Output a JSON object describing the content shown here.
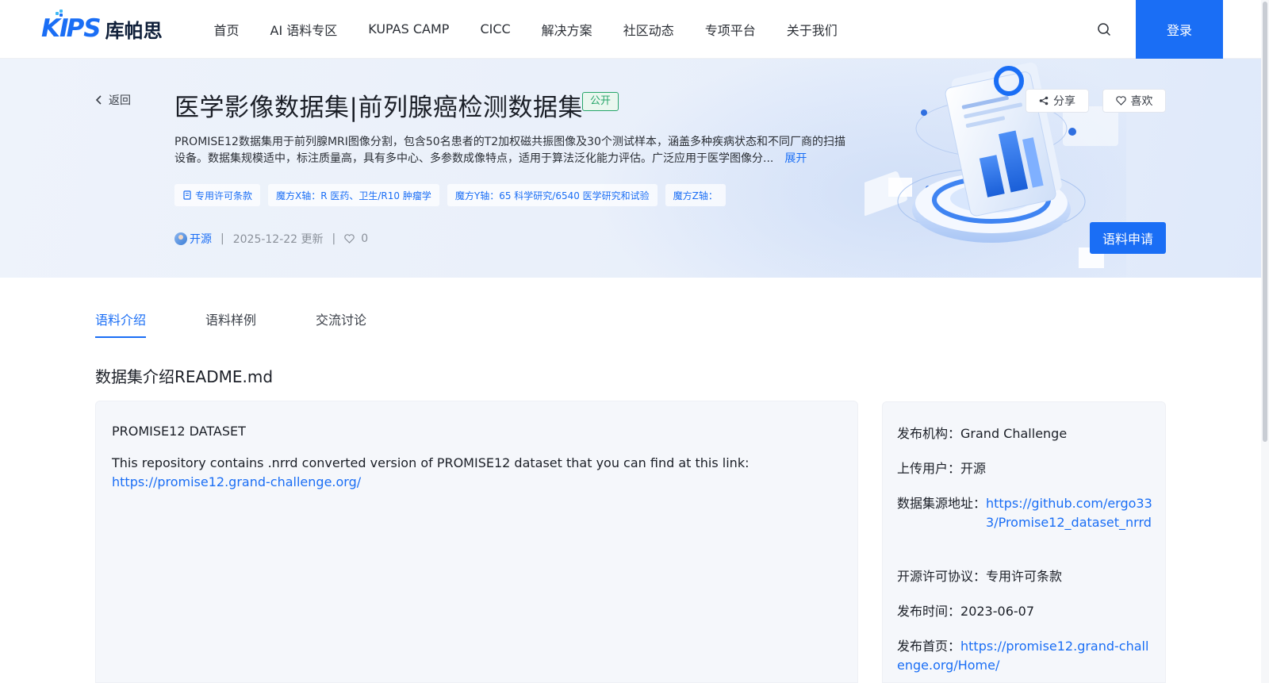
{
  "header": {
    "logo_text": "库帕思",
    "nav": [
      "首页",
      "AI 语料专区",
      "KUPAS CAMP",
      "CICC",
      "解决方案",
      "社区动态",
      "专项平台",
      "关于我们"
    ],
    "login_label": "登录"
  },
  "banner": {
    "back_label": "返回",
    "title": "医学影像数据集|前列腺癌检测数据集",
    "badge": "公开",
    "description": "PROMISE12数据集用于前列腺MRI图像分割，包含50名患者的T2加权磁共振图像及30个测试样本，涵盖多种疾病状态和不同厂商的扫描设备。数据集规模适中，标注质量高，具有多中心、多参数成像特点，适用于算法泛化能力评估。广泛应用于医学图像分...",
    "expand_label": "展开",
    "tags": [
      "专用许可条款",
      "魔方X轴：R 医药、卫生/R10 肿瘤学",
      "魔方Y轴：65 科学研究/6540 医学研究和试验",
      "魔方Z轴："
    ],
    "user": "开源",
    "updated": "2025-12-22 更新",
    "likes": "0",
    "share_label": "分享",
    "like_label": "喜欢",
    "apply_label": "语料申请"
  },
  "tabs": [
    "语料介绍",
    "语料样例",
    "交流讨论"
  ],
  "section_title": "数据集介绍README.md",
  "readme": {
    "heading": "PROMISE12 DATASET",
    "text": "This repository contains .nrrd converted version of PROMISE12 dataset that you can find at this link:",
    "link": "https://promise12.grand-challenge.org/"
  },
  "info": [
    {
      "key": "发布机构：",
      "value": "Grand Challenge",
      "link": false
    },
    {
      "key": "上传用户：",
      "value": "开源",
      "link": false
    },
    {
      "key": "数据集源地址：",
      "value": "https://github.com/ergo333/Promise12_dataset_nrrd",
      "link": true
    },
    {
      "key": "开源许可协议：",
      "value": "专用许可条款",
      "link": false
    },
    {
      "key": "发布时间：",
      "value": "2023-06-07",
      "link": false
    },
    {
      "key": "发布首页：",
      "value": "https://promise12.grand-challenge.org/Home/",
      "link": true
    }
  ]
}
